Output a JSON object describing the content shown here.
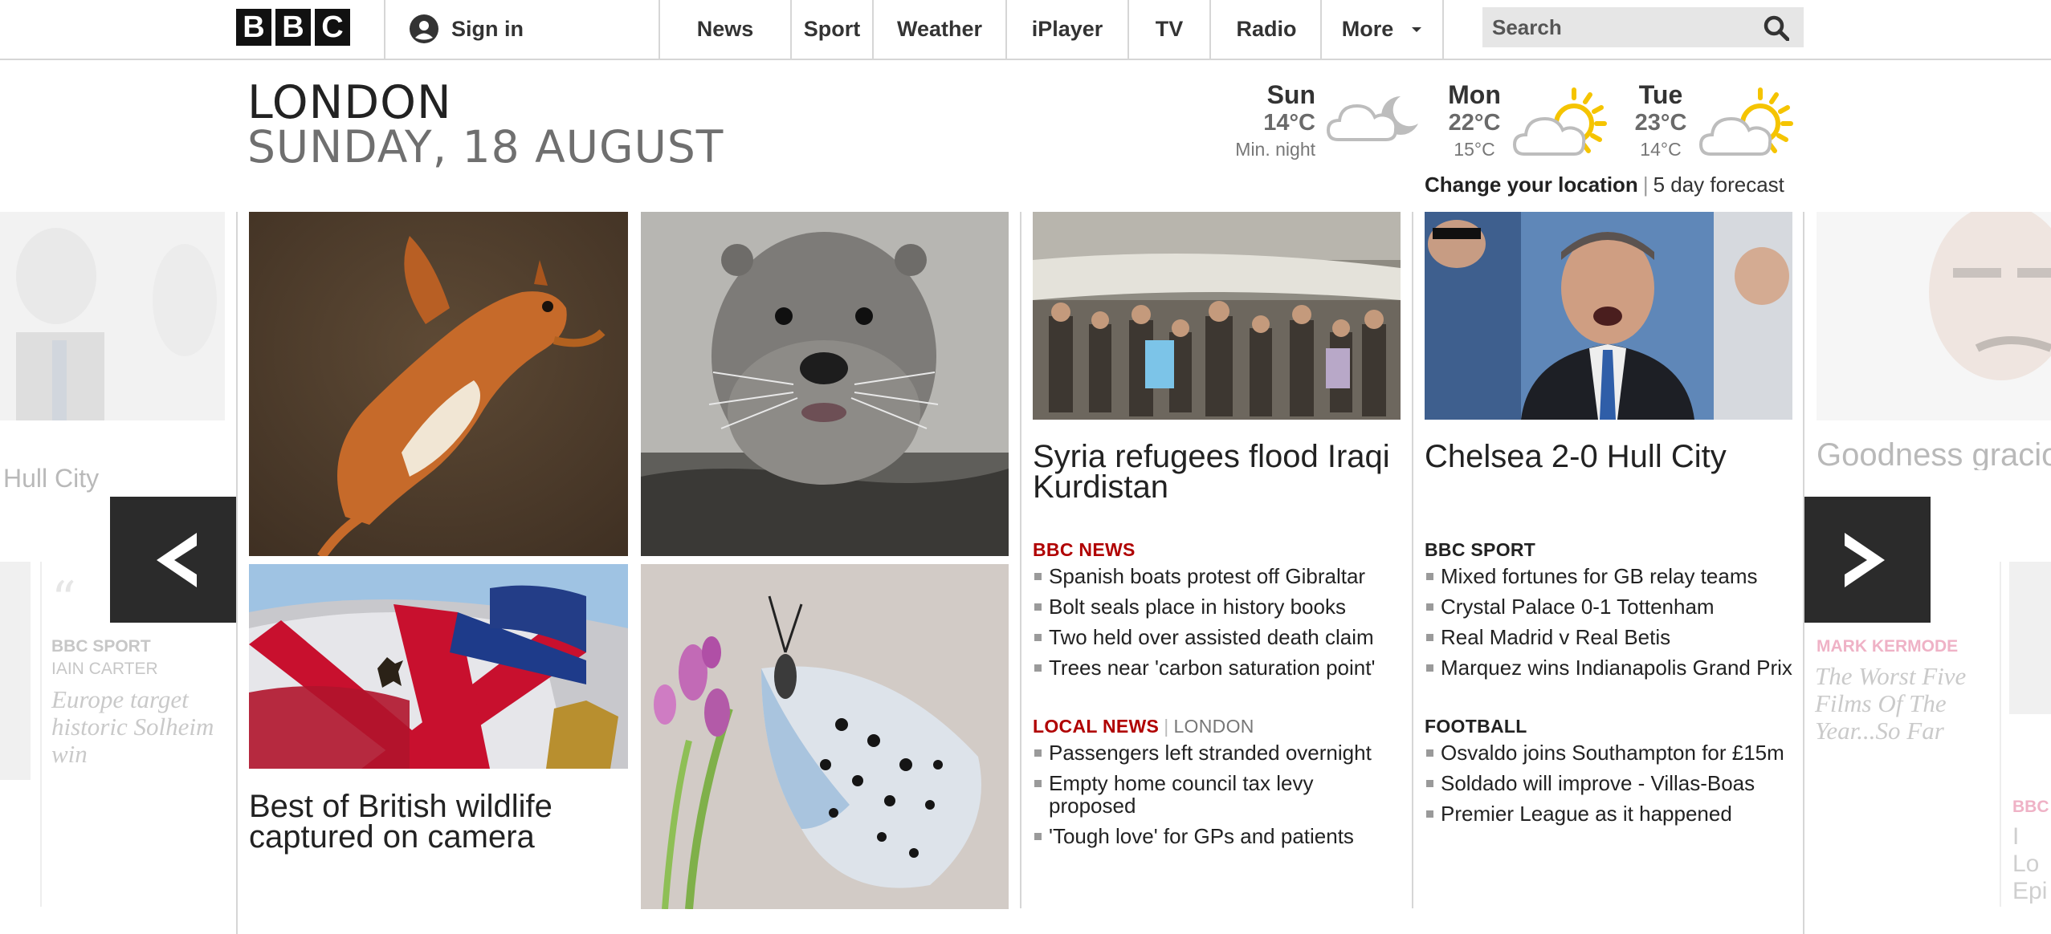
{
  "brand": {
    "letters": [
      "B",
      "B",
      "C"
    ]
  },
  "nav": {
    "sign_in": "Sign in",
    "items": [
      "News",
      "Sport",
      "Weather",
      "iPlayer",
      "TV",
      "Radio"
    ],
    "more": "More",
    "search_placeholder": "Search"
  },
  "location": {
    "city": "LONDON",
    "date": "SUNDAY, 18 AUGUST"
  },
  "weather": {
    "days": [
      {
        "day": "Sun",
        "high": "14°C",
        "low": "Min. night",
        "icon": "partly-cloudy-night-icon"
      },
      {
        "day": "Mon",
        "high": "22°C",
        "low": "15°C",
        "icon": "sun-behind-cloud-icon"
      },
      {
        "day": "Tue",
        "high": "23°C",
        "low": "14°C",
        "icon": "sun-behind-cloud-icon"
      }
    ],
    "change_location": "Change your location",
    "forecast_link": "5 day forecast"
  },
  "carousel": {
    "left_ghost": {
      "headline": "Hull City",
      "section": "BBC SPORT",
      "author": "IAIN CARTER",
      "blog_title": "Europe target historic Solheim win"
    },
    "wildlife": {
      "headline": "Best of British wildlife captured on camera"
    },
    "news": {
      "headline": "Syria refugees flood Iraqi Kurdistan",
      "section": "BBC NEWS",
      "items": [
        "Spanish boats protest off Gibraltar",
        "Bolt seals place in history books",
        "Two held over assisted death claim",
        "Trees near 'carbon saturation point'"
      ],
      "local_section": "LOCAL NEWS",
      "local_area": "LONDON",
      "local_items": [
        "Passengers left stranded overnight",
        "Empty home council tax levy proposed",
        "'Tough love' for GPs and patients"
      ]
    },
    "sport": {
      "headline": "Chelsea 2-0 Hull City",
      "section": "BBC SPORT",
      "items": [
        "Mixed fortunes for GB relay teams",
        "Crystal Palace 0-1 Tottenham",
        "Real Madrid v Real Betis",
        "Marquez wins Indianapolis Grand Prix"
      ],
      "football_section": "FOOTBALL",
      "football_items": [
        "Osvaldo joins Southampton for £15m",
        "Soldado will improve - Villas-Boas",
        "Premier League as it happened"
      ]
    },
    "right_ghost": {
      "headline": "Goodness gracious a comedy reunion",
      "section": "MARK KERMODE",
      "blog_title": "The Worst Five Films Of The Year...So Far",
      "section2": "BBC",
      "blog2": "I Lo Epi"
    }
  },
  "colors": {
    "news_red": "#b00000",
    "sport_yellow": "#f5c400",
    "arrow_bg": "#2b2b2b",
    "kermode_pink": "#e8a0b8"
  }
}
